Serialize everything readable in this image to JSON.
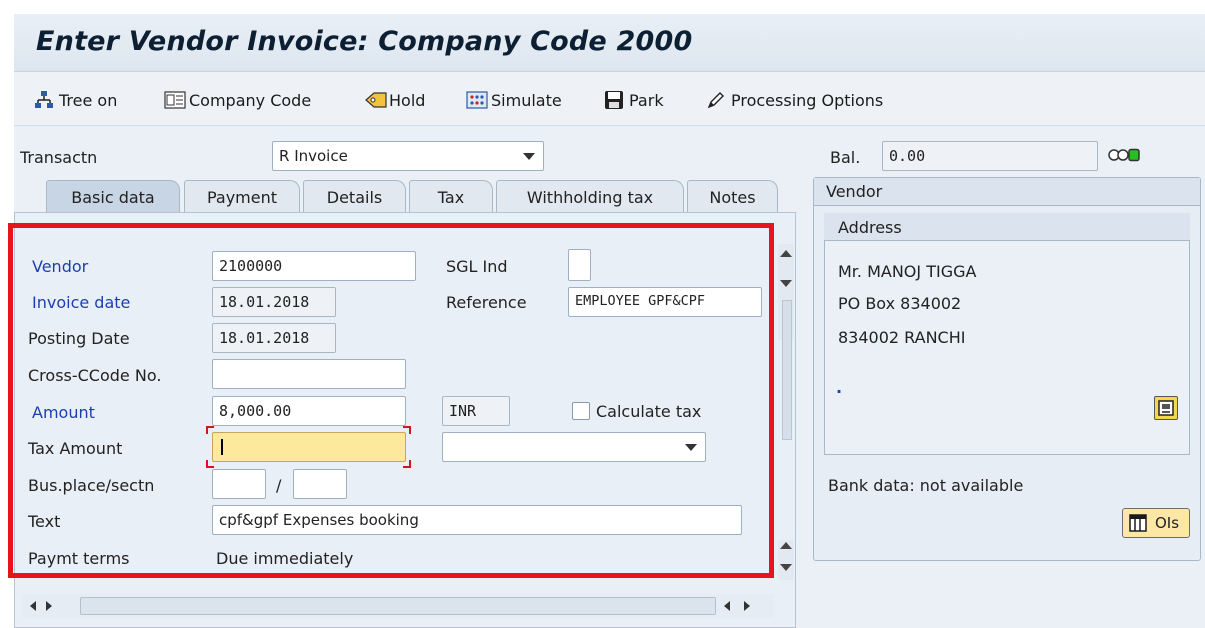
{
  "header": {
    "title": "Enter Vendor Invoice: Company Code 2000"
  },
  "toolbar": {
    "tree_on": "Tree on",
    "company_code": "Company Code",
    "hold": "Hold",
    "simulate": "Simulate",
    "park": "Park",
    "processing_options": "Processing Options"
  },
  "transaction": {
    "label": "Transactn",
    "value": "R Invoice"
  },
  "balance": {
    "label": "Bal.",
    "value": "0.00",
    "status_colors": [
      "#ffffff",
      "#ffffff",
      "#22c21a"
    ]
  },
  "tabs": [
    {
      "label": "Basic data",
      "active": true
    },
    {
      "label": "Payment"
    },
    {
      "label": "Details"
    },
    {
      "label": "Tax"
    },
    {
      "label": "Withholding tax"
    },
    {
      "label": "Notes"
    }
  ],
  "form": {
    "vendor": {
      "label": "Vendor",
      "value": "2100000"
    },
    "sgl_ind": {
      "label": "SGL Ind",
      "value": ""
    },
    "invoice_date": {
      "label": "Invoice date",
      "value": "18.01.2018"
    },
    "reference": {
      "label": "Reference",
      "value": "EMPLOYEE GPF&CPF"
    },
    "posting_date": {
      "label": "Posting Date",
      "value": "18.01.2018"
    },
    "cross_ccode": {
      "label": "Cross-CCode No.",
      "value": ""
    },
    "amount": {
      "label": "Amount",
      "value": "8,000.00",
      "currency": "INR"
    },
    "calculate_tax": {
      "label": "Calculate tax",
      "checked": false
    },
    "tax_amount": {
      "label": "Tax Amount",
      "value": ""
    },
    "tax_code": {
      "value": ""
    },
    "bus_place": {
      "label": "Bus.place/sectn",
      "separator": "/",
      "value1": "",
      "value2": ""
    },
    "text": {
      "label": "Text",
      "value": "cpf&gpf Expenses booking"
    },
    "paymt_terms": {
      "label": "Paymt terms",
      "value": "Due immediately"
    }
  },
  "vendor_panel": {
    "title": "Vendor",
    "address_header": "Address",
    "address_lines": [
      "Mr. MANOJ TIGGA",
      "PO Box 834002",
      "834002 RANCHI"
    ],
    "dot": ".",
    "bank_data": "Bank data: not available",
    "ois_button": "OIs"
  },
  "colors": {
    "highlight": "#e8141c",
    "required_field": "#fde99b",
    "label_blue": "#1c3fae"
  }
}
